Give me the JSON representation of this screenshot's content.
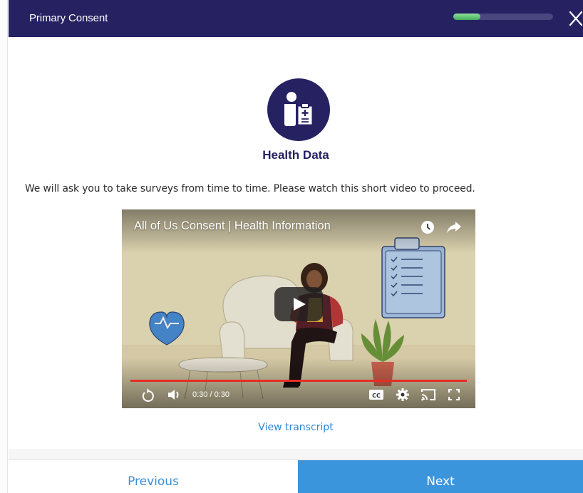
{
  "header": {
    "title": "Primary Consent",
    "progress_fraction": 0.27,
    "close_icon": "close-icon"
  },
  "topic": {
    "icon": "health-data-icon",
    "title": "Health Data",
    "intro": "We will ask you to take surveys from time to time. Please watch this short video to proceed."
  },
  "video": {
    "title": "All of Us Consent | Health Information",
    "time": "0:30 / 0:30",
    "played_fraction": 1.0,
    "controls": [
      "replay-icon",
      "volume-icon",
      "captions-icon",
      "settings-icon",
      "cast-icon",
      "fullscreen-icon"
    ],
    "top_icons": [
      "watch-later-icon",
      "share-icon"
    ]
  },
  "links": {
    "transcript": "View transcript"
  },
  "footer": {
    "previous_label": "Previous",
    "next_label": "Next"
  },
  "colors": {
    "brand_navy": "#262262",
    "accent_blue": "#3b95dd",
    "progress_green": "#45b05a",
    "video_progress_red": "#e52d27"
  }
}
